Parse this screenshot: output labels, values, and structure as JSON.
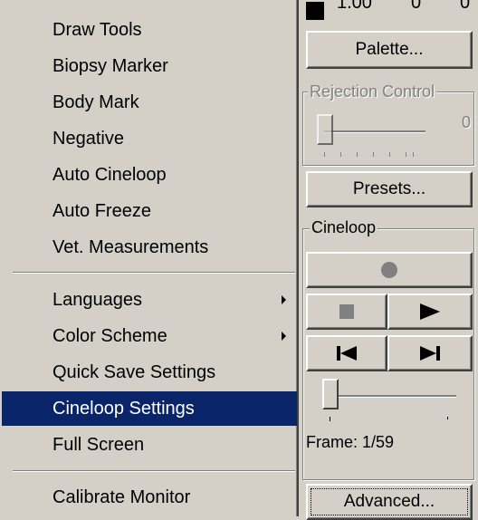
{
  "menu": {
    "items": [
      {
        "label": "Draw Tools"
      },
      {
        "label": "Biopsy Marker"
      },
      {
        "label": "Body Mark"
      },
      {
        "label": "Negative"
      },
      {
        "label": "Auto Cineloop"
      },
      {
        "label": "Auto Freeze"
      },
      {
        "label": "Vet. Measurements"
      },
      {
        "label": "Languages",
        "submenu": true
      },
      {
        "label": "Color Scheme",
        "submenu": true
      },
      {
        "label": "Quick Save Settings"
      },
      {
        "label": "Cineloop Settings",
        "highlighted": true
      },
      {
        "label": "Full Screen"
      },
      {
        "label": "Calibrate Monitor"
      }
    ],
    "highlight_color": "#0a246a"
  },
  "panel": {
    "top_values": {
      "first": "1.00",
      "second": "0",
      "third": "0"
    },
    "palette_button": "Palette...",
    "rejection_control": {
      "label": "Rejection Control",
      "value": "0"
    },
    "presets_button": "Presets...",
    "cineloop": {
      "label": "Cineloop",
      "frame_text": "Frame: 1/59"
    },
    "advanced_button": "Advanced..."
  }
}
